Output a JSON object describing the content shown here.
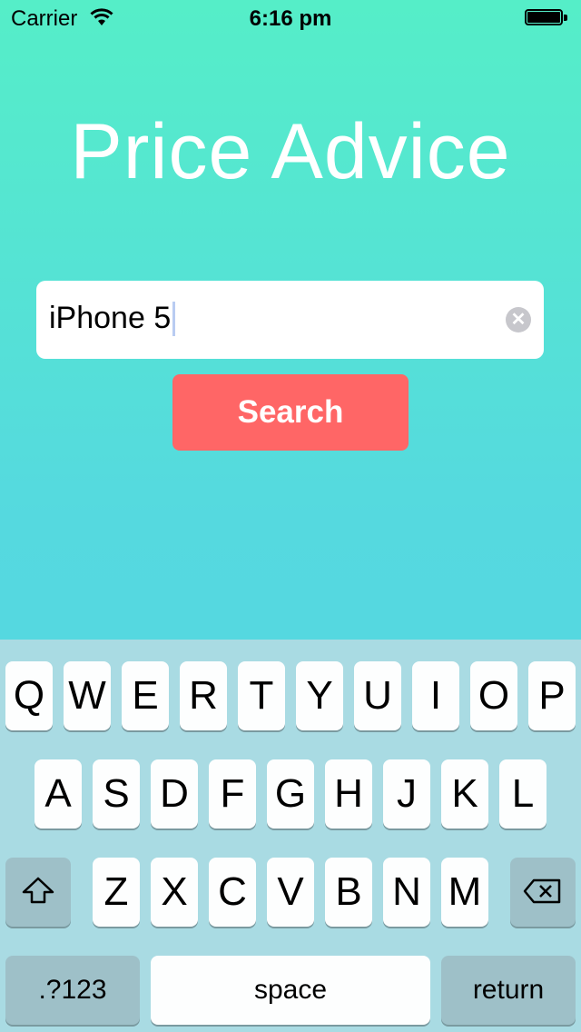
{
  "status_bar": {
    "carrier": "Carrier",
    "time": "6:16 pm",
    "icons": [
      "wifi-icon",
      "battery-icon"
    ]
  },
  "app": {
    "title": "Price Advice",
    "search_value": "iPhone 5",
    "search_button_label": "Search",
    "accent_color": "#ff6666"
  },
  "keyboard": {
    "row1": [
      "Q",
      "W",
      "E",
      "R",
      "T",
      "Y",
      "U",
      "I",
      "O",
      "P"
    ],
    "row2": [
      "A",
      "S",
      "D",
      "F",
      "G",
      "H",
      "J",
      "K",
      "L"
    ],
    "row3": [
      "Z",
      "X",
      "C",
      "V",
      "B",
      "N",
      "M"
    ],
    "numbers_label": ".?123",
    "space_label": "space",
    "return_label": "return",
    "shift_icon": "shift-icon",
    "delete_icon": "delete-icon"
  }
}
